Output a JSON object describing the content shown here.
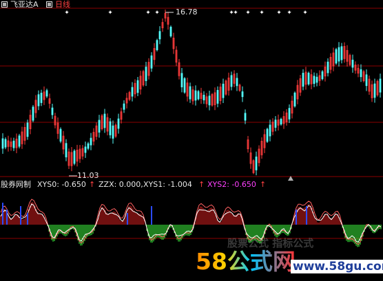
{
  "header": {
    "stock_name": "飞亚达A",
    "period": "日线",
    "name_color": "#e7e7e7",
    "period_color": "#ff4040"
  },
  "price_chart": {
    "high_label": "16.78",
    "low_label": "11.03",
    "up_color": "#ff3c3c",
    "down_color": "#54fcfc",
    "grid_color": "#8b0000",
    "marker_color": "#ffffff"
  },
  "indicator": {
    "name": "股券网制",
    "xys0_label": "XYS0: -0.650",
    "zzx_label": "ZZX: 0.000,",
    "xys1_label": "XYS1: -1.004",
    "xys2_label": "XYS2: -0.650",
    "label_color": "#e7e7e7",
    "xys2_color": "#ff40ff",
    "arrow_color": "#ff4040",
    "pos_color": "#e02020",
    "neg_color": "#40ff40",
    "blue_color": "#2b4bff"
  },
  "watermark": {
    "main": "58公式网",
    "url": "www.58gu.com",
    "faint": "股票公式 指标公式"
  }
}
